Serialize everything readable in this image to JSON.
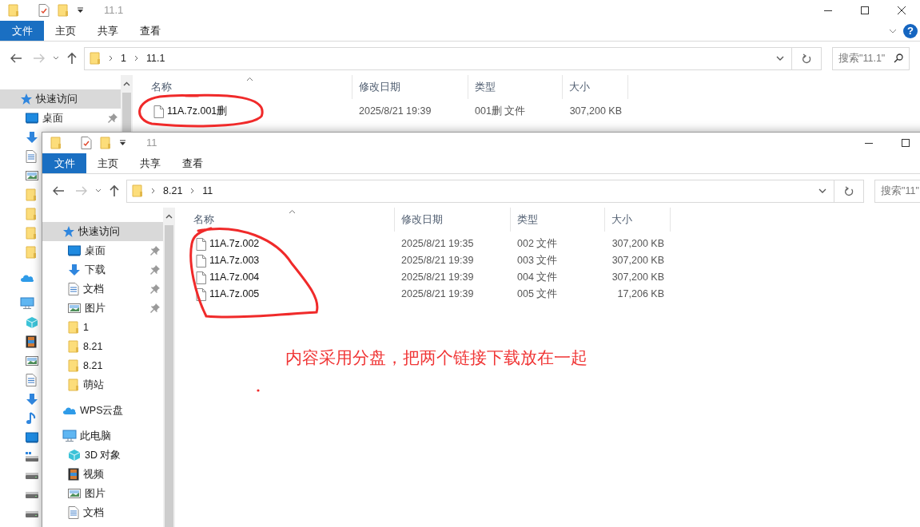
{
  "windows": [
    {
      "title": "11.1",
      "ribbon_tabs": [
        {
          "label": "文件",
          "selected": true
        },
        {
          "label": "主页",
          "selected": false
        },
        {
          "label": "共享",
          "selected": false
        },
        {
          "label": "查看",
          "selected": false
        }
      ],
      "help": "?",
      "path": [
        "1",
        "11.1"
      ],
      "search": {
        "placeholder": "搜索\"11.1\""
      },
      "sidebar": [
        {
          "kind": "quick",
          "label": "快速访问",
          "selected": true,
          "children": [
            {
              "kind": "desktop",
              "label": "桌面",
              "pinned": true,
              "selected": false
            },
            {
              "kind": "download",
              "selected": false
            },
            {
              "kind": "document",
              "selected": false
            },
            {
              "kind": "pictures",
              "selected": false
            },
            {
              "kind": "folder",
              "selected": false
            },
            {
              "kind": "folder",
              "selected": false
            },
            {
              "kind": "folder",
              "selected": false
            },
            {
              "kind": "folder",
              "selected": false
            }
          ]
        },
        {
          "kind": "cloud",
          "selected": false
        },
        {
          "kind": "pc",
          "selected": false,
          "children": [
            {
              "kind": "objects",
              "selected": false
            },
            {
              "kind": "video",
              "selected": false
            },
            {
              "kind": "pictures",
              "selected": false
            },
            {
              "kind": "document",
              "selected": false
            },
            {
              "kind": "download",
              "selected": false
            },
            {
              "kind": "music",
              "selected": false
            },
            {
              "kind": "desktop",
              "selected": false
            },
            {
              "kind": "sysdrive",
              "selected": false
            },
            {
              "kind": "drive",
              "selected": false
            },
            {
              "kind": "drive",
              "selected": false
            },
            {
              "kind": "drive",
              "selected": false
            }
          ]
        }
      ],
      "columns": [
        "名称",
        "修改日期",
        "类型",
        "大小"
      ],
      "files": [
        {
          "name": "11A.7z.001删",
          "modified": "2025/8/21 19:39",
          "type": "001删 文件",
          "size": "307,200 KB"
        }
      ]
    },
    {
      "title": "11",
      "ribbon_tabs": [
        {
          "label": "文件",
          "selected": true
        },
        {
          "label": "主页",
          "selected": false
        },
        {
          "label": "共享",
          "selected": false
        },
        {
          "label": "查看",
          "selected": false
        }
      ],
      "path": [
        "8.21",
        "11"
      ],
      "search": {
        "placeholder": "搜索\"11\""
      },
      "sidebar": [
        {
          "kind": "quick",
          "label": "快速访问",
          "selected": true,
          "children": [
            {
              "kind": "desktop",
              "label": "桌面",
              "pinned": true,
              "selected": false
            },
            {
              "kind": "download",
              "label": "下载",
              "pinned": true,
              "selected": false
            },
            {
              "kind": "document",
              "label": "文档",
              "pinned": true,
              "selected": false
            },
            {
              "kind": "pictures",
              "label": "图片",
              "pinned": true,
              "selected": false
            },
            {
              "kind": "folder",
              "label": "1",
              "pinned": false,
              "selected": false
            },
            {
              "kind": "folder",
              "label": "8.21",
              "pinned": false,
              "selected": false
            },
            {
              "kind": "folder",
              "label": "8.21",
              "pinned": false,
              "selected": false
            },
            {
              "kind": "folder",
              "label": "萌站",
              "pinned": false,
              "selected": false
            }
          ]
        },
        {
          "kind": "cloud",
          "label": "WPS云盘",
          "selected": false
        },
        {
          "kind": "pc",
          "label": "此电脑",
          "selected": false,
          "children": [
            {
              "kind": "objects",
              "label": "3D 对象",
              "selected": false
            },
            {
              "kind": "video",
              "label": "视频",
              "selected": false
            },
            {
              "kind": "pictures",
              "label": "图片",
              "selected": false
            },
            {
              "kind": "document",
              "label": "文档",
              "selected": false
            }
          ]
        }
      ],
      "columns": [
        "名称",
        "修改日期",
        "类型",
        "大小"
      ],
      "files": [
        {
          "name": "11A.7z.002",
          "modified": "2025/8/21 19:35",
          "type": "002 文件",
          "size": "307,200 KB"
        },
        {
          "name": "11A.7z.003",
          "modified": "2025/8/21 19:39",
          "type": "003 文件",
          "size": "307,200 KB"
        },
        {
          "name": "11A.7z.004",
          "modified": "2025/8/21 19:39",
          "type": "004 文件",
          "size": "307,200 KB"
        },
        {
          "name": "11A.7z.005",
          "modified": "2025/8/21 19:39",
          "type": "005 文件",
          "size": "17,206 KB"
        }
      ]
    }
  ],
  "annotation": {
    "text": "内容采用分盘，把两个链接下载放在一起"
  }
}
